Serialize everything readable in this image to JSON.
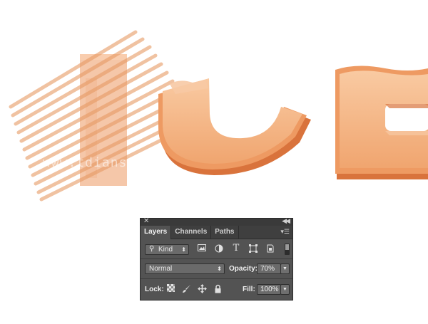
{
  "watermark": "www.tdians.com",
  "panel": {
    "tabs": [
      {
        "label": "Layers"
      },
      {
        "label": "Channels"
      },
      {
        "label": "Paths"
      }
    ],
    "filter": {
      "kind_label": "Kind"
    },
    "blend": {
      "mode": "Normal",
      "opacity_label": "Opacity:",
      "opacity_value": "70%"
    },
    "lock": {
      "label": "Lock:",
      "fill_label": "Fill:",
      "fill_value": "100%"
    }
  },
  "colors": {
    "art_light": "#f8c49a",
    "art_mid": "#eea874",
    "art_dark": "#d9733c",
    "panel_bg": "#535353"
  }
}
